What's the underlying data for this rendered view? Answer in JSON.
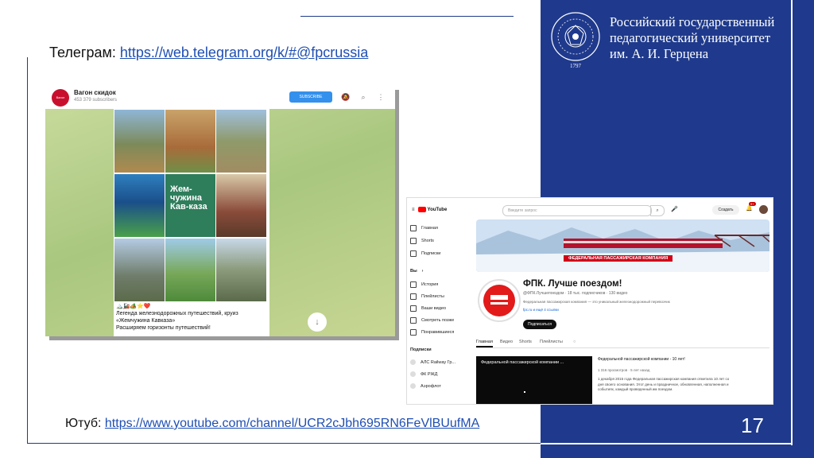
{
  "slide": {
    "university_lines": [
      "Российский государственный",
      "педагогический университет",
      "им. А. И. Герцена"
    ],
    "seal_year": "1797",
    "page_number": "17",
    "colors": {
      "panel": "#1f3a8c",
      "link": "#1f4fb3"
    }
  },
  "telegram_caption": {
    "label": "Телеграм: ",
    "link": "https://web.telegram.org/k/#@fpcrussia"
  },
  "youtube_caption": {
    "label": "Ютуб: ",
    "link": "https://www.youtube.com/channel/UCR2cJbh695RN6FeVlBUufMA"
  },
  "telegram": {
    "channel_name": "Вагон скидок",
    "avatar_text": "Вагон Скидок",
    "subscribers": "453 379 subscribers",
    "subscribe_label": "SUBSCRIBE",
    "icons": [
      "bell-off-icon",
      "search-icon",
      "more-icon"
    ],
    "tile_big_text": "Жем-чужина Кав-каза",
    "post_emojis": "🏔️🚂🏕️⭐❤️",
    "post_lines": [
      "Легенда железнодорожных путешествий, круиз",
      "«Жемчужина Кавказа»",
      "Расширяем горизонты путешествий!"
    ],
    "scroll_icon": "arrow-down-icon"
  },
  "youtube": {
    "logo": "YouTube",
    "nav_main": [
      "Главная",
      "Shorts",
      "Подписки"
    ],
    "you_label": "Вы",
    "nav_you": [
      "История",
      "Плейлисты",
      "Ваши видео",
      "Смотреть позже",
      "Понравившиеся"
    ],
    "subs_header": "Подписки",
    "subs": [
      "АЛС Railway Гр...",
      "ФК РЖД",
      "Аэрофлот"
    ],
    "search_placeholder": "Введите запрос",
    "create_label": "Создать",
    "notif_count": "9+",
    "banner_label": "ФЕДЕРАЛЬНАЯ ПАССАЖИРСКАЯ КОМПАНИЯ",
    "channel_name": "ФПК. Лучше поездом!",
    "channel_meta": "@ФПК.Лучшепоездом · 18 тыс. подписчиков · 130 видео",
    "channel_desc": "Федеральная пассажирская компания — это уникальный железнодорожный перевозчик",
    "channel_link": "fpc.ru и ещё 4 ссылки",
    "subscribe_label": "Подписаться",
    "tabs": [
      "Главная",
      "Видео",
      "Shorts",
      "Плейлисты"
    ],
    "video_title": "Федеральной пассажирской компании ...",
    "video_heading": "Федеральной пассажирской компании - 10 лет!",
    "video_meta": "1 316 просмотров · 5 лет назад",
    "video_desc": "1 декабря 2015 года Федеральная пассажирская компания отметила 10 лет со дня своего основания. Этот день и праздничное, обновленная, наполненная и событиях, каждый проведенный им поездом."
  }
}
